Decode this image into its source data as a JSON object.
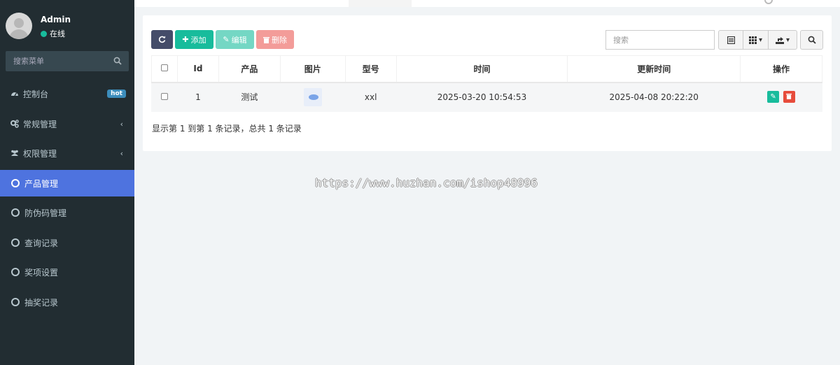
{
  "user": {
    "name": "Admin",
    "status": "在线"
  },
  "sidebar": {
    "search_placeholder": "搜索菜单",
    "items": [
      {
        "label": "控制台",
        "icon": "dashboard-icon",
        "badge": "hot"
      },
      {
        "label": "常规管理",
        "icon": "cogs-icon",
        "chevron": "‹"
      },
      {
        "label": "权限管理",
        "icon": "group-icon",
        "chevron": "‹"
      },
      {
        "label": "产品管理",
        "icon": "circle-icon",
        "active": true
      },
      {
        "label": "防伪码管理",
        "icon": "circle-icon"
      },
      {
        "label": "查询记录",
        "icon": "circle-icon"
      },
      {
        "label": "奖项设置",
        "icon": "circle-icon"
      },
      {
        "label": "抽奖记录",
        "icon": "circle-icon"
      }
    ]
  },
  "toolbar": {
    "refresh_icon": "refresh-icon",
    "add_label": "添加",
    "edit_label": "编辑",
    "delete_label": "删除",
    "search_placeholder": "搜索"
  },
  "table": {
    "headers": [
      "Id",
      "产品",
      "图片",
      "型号",
      "时间",
      "更新时间",
      "操作"
    ],
    "rows": [
      {
        "id": "1",
        "product": "测试",
        "model": "xxl",
        "time": "2025-03-20 10:54:53",
        "updated": "2025-04-08 20:22:20"
      }
    ]
  },
  "footer": {
    "summary": "显示第 1 到第 1 条记录，总共 1 条记录"
  },
  "watermark": "https://www.huzhan.com/ishop48996",
  "colors": {
    "sidebar_bg": "#222d32",
    "active_menu": "#4e73df",
    "refresh_btn": "#444c69",
    "add_btn": "#18bc9c",
    "edit_btn": "#74d7c4",
    "delete_btn": "#f39c99",
    "delete_row_btn": "#e74c3c",
    "hot_badge": "#3c8dbc",
    "online_dot": "#18bc9c"
  }
}
